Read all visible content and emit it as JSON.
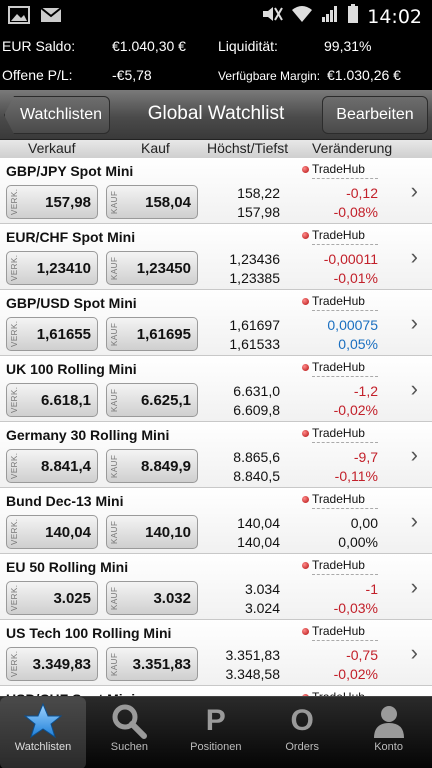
{
  "status_bar": {
    "time": "14:02"
  },
  "account": {
    "eur_saldo_label": "EUR Saldo:",
    "eur_saldo_value": "€1.040,30 €",
    "liquiditaet_label": "Liquidität:",
    "liquiditaet_value": "99,31%",
    "offene_pl_label": "Offene P/L:",
    "offene_pl_value": "-€5,78",
    "margin_label": "Verfügbare Margin:",
    "margin_value": "€1.030,26 €"
  },
  "navbar": {
    "back_label": "Watchlisten",
    "title": "Global Watchlist",
    "edit_label": "Bearbeiten"
  },
  "columns": {
    "verkauf": "Verkauf",
    "kauf": "Kauf",
    "hoechst_tiefst": "Höchst/Tiefst",
    "veraenderung": "Veränderung"
  },
  "sell_tag": "VERK.",
  "buy_tag": "KAUF",
  "provider": "TradeHub",
  "rows": [
    {
      "name": "GBP/JPY Spot Mini",
      "sell": "157,98",
      "buy": "158,04",
      "high": "158,22",
      "low": "157,98",
      "change": "-0,12",
      "change_pct": "-0,08%",
      "dir": "neg"
    },
    {
      "name": "EUR/CHF Spot Mini",
      "sell": "1,23410",
      "buy": "1,23450",
      "high": "1,23436",
      "low": "1,23385",
      "change": "-0,00011",
      "change_pct": "-0,01%",
      "dir": "neg"
    },
    {
      "name": "GBP/USD Spot Mini",
      "sell": "1,61655",
      "buy": "1,61695",
      "high": "1,61697",
      "low": "1,61533",
      "change": "0,00075",
      "change_pct": "0,05%",
      "dir": "pos"
    },
    {
      "name": "UK 100 Rolling Mini",
      "sell": "6.618,1",
      "buy": "6.625,1",
      "high": "6.631,0",
      "low": "6.609,8",
      "change": "-1,2",
      "change_pct": "-0,02%",
      "dir": "neg"
    },
    {
      "name": "Germany 30 Rolling Mini",
      "sell": "8.841,4",
      "buy": "8.849,9",
      "high": "8.865,6",
      "low": "8.840,5",
      "change": "-9,7",
      "change_pct": "-0,11%",
      "dir": "neg"
    },
    {
      "name": "Bund Dec-13 Mini",
      "sell": "140,04",
      "buy": "140,10",
      "high": "140,04",
      "low": "140,04",
      "change": "0,00",
      "change_pct": "0,00%",
      "dir": "neu"
    },
    {
      "name": "EU 50 Rolling Mini",
      "sell": "3.025",
      "buy": "3.032",
      "high": "3.034",
      "low": "3.024",
      "change": "-1",
      "change_pct": "-0,03%",
      "dir": "neg"
    },
    {
      "name": "US Tech 100 Rolling Mini",
      "sell": "3.349,83",
      "buy": "3.351,83",
      "high": "3.351,83",
      "low": "3.348,58",
      "change": "-0,75",
      "change_pct": "-0,02%",
      "dir": "neg"
    },
    {
      "name": "USD/CHF Spot Mini",
      "sell": "",
      "buy": "",
      "high": "",
      "low": "",
      "change": "",
      "change_pct": "",
      "dir": "neu"
    }
  ],
  "tabs": [
    {
      "label": "Watchlisten",
      "icon": "star-icon",
      "active": true
    },
    {
      "label": "Suchen",
      "icon": "search-icon",
      "active": false
    },
    {
      "label": "Positionen",
      "icon": "p-letter-icon",
      "glyph": "P",
      "active": false
    },
    {
      "label": "Orders",
      "icon": "o-letter-icon",
      "glyph": "O",
      "active": false
    },
    {
      "label": "Konto",
      "icon": "person-icon",
      "active": false
    }
  ],
  "colors": {
    "negative": "#c2202a",
    "positive": "#1a6fc0",
    "provider_dot": "#c41414"
  }
}
